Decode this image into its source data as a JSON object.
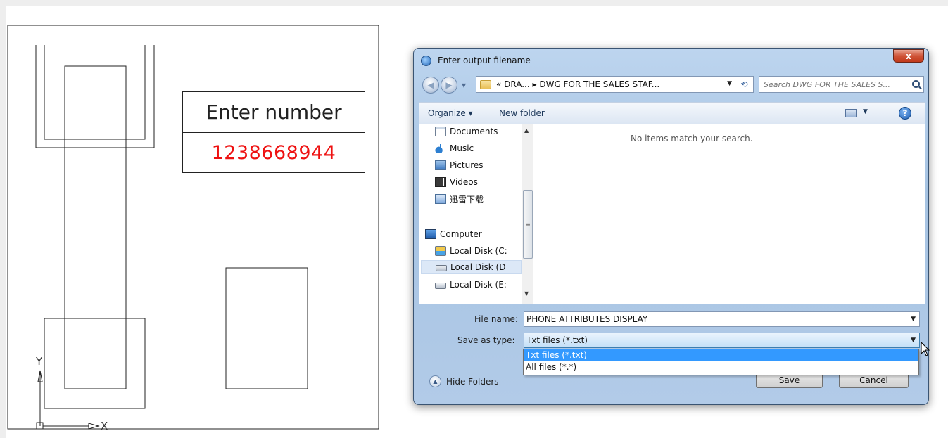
{
  "drawing": {
    "attribute_header": "Enter number",
    "attribute_value": "1238668944",
    "axis_y": "Y",
    "axis_x": "X"
  },
  "dialog": {
    "title": "Enter output filename",
    "close_label": "x",
    "breadcrumb": "« DRA... ▸ DWG FOR THE SALES STAF...",
    "search_placeholder": "Search DWG FOR THE SALES S...",
    "toolbar": {
      "organize": "Organize ▾",
      "new_folder": "New folder",
      "help": "?"
    },
    "nav_items": [
      {
        "label": "Documents",
        "icon": "documents-icon"
      },
      {
        "label": "Music",
        "icon": "music-icon"
      },
      {
        "label": "Pictures",
        "icon": "pictures-icon"
      },
      {
        "label": "Videos",
        "icon": "videos-icon"
      },
      {
        "label": "迅雷下载",
        "icon": "folder-icon"
      },
      {
        "label": "Computer",
        "icon": "computer-icon"
      },
      {
        "label": "Local Disk (C:",
        "icon": "local-disk-c-icon"
      },
      {
        "label": "Local Disk (D",
        "icon": "local-disk-icon"
      },
      {
        "label": "Local Disk (E:",
        "icon": "local-disk-icon"
      }
    ],
    "selected_nav": "Local Disk (D",
    "empty_message": "No items match your search.",
    "file_name_label": "File name:",
    "file_name_value": "PHONE ATTRIBUTES DISPLAY",
    "save_as_type_label": "Save as type:",
    "save_as_type_value": "Txt files (*.txt)",
    "type_options": [
      "Txt files (*.txt)",
      "All files (*.*)"
    ],
    "hide_folders": "Hide Folders",
    "save_button": "Save",
    "cancel_button": "Cancel"
  }
}
